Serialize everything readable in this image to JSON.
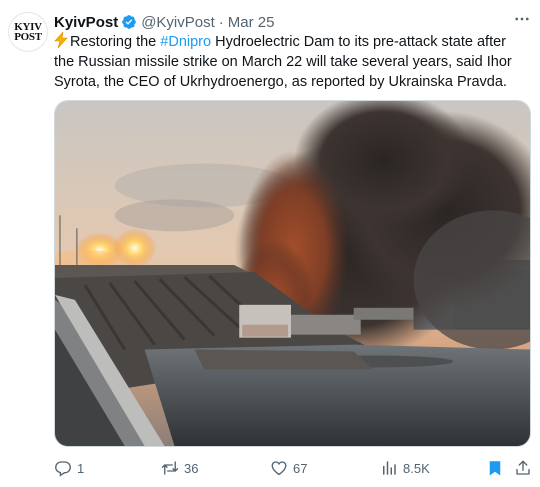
{
  "author": {
    "display_name": "KyivPost",
    "handle": "@KyivPost",
    "separator": "·",
    "date": "Mar 25",
    "avatar_line1": "KYIV",
    "avatar_line2": "POST",
    "verified": true
  },
  "tweet": {
    "text_before_hashtag": "Restoring the ",
    "hashtag": "#Dnipro",
    "text_after_hashtag": " Hydroelectric Dam to its pre-attack state after the Russian missile strike on March 22 will take several years, said Ihor Syrota, the CEO of Ukrhydroenergo, as reported by Ukrainska Pravda.",
    "leading_emoji": "high-voltage-emoji"
  },
  "media": {
    "subject": "photo",
    "icon": "photo-image"
  },
  "actions": {
    "replies": "1",
    "retweets": "36",
    "likes": "67",
    "views": "8.5K"
  },
  "colors": {
    "text": "#0f1419",
    "secondary": "#536471",
    "link": "#1d9bf0",
    "verified": "#1d9bf0",
    "bookmark_active": "#1d9bf0"
  }
}
